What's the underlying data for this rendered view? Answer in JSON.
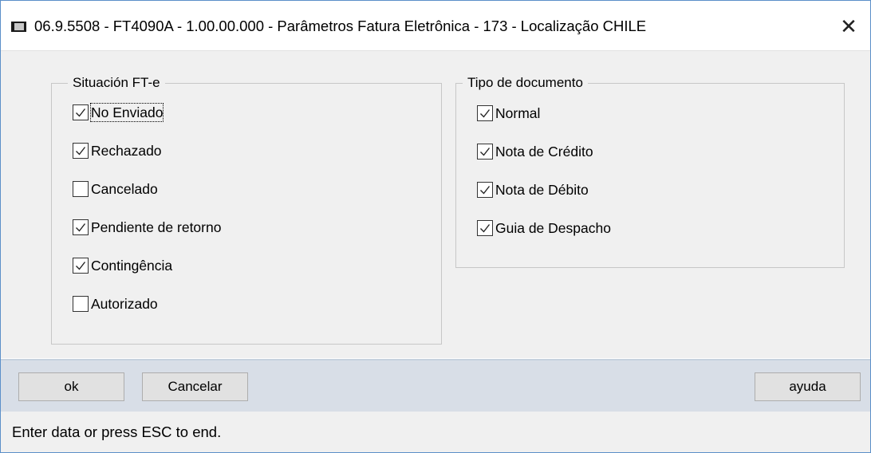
{
  "window": {
    "title": "06.9.5508 - FT4090A - 1.00.00.000 - Parâmetros Fatura Eletrônica - 173 - Localização CHILE",
    "close_glyph": "✕",
    "app_icon": "window-app-icon"
  },
  "situacion": {
    "label": "Situación FT-e",
    "items": [
      {
        "label": "No Enviado",
        "checked": true
      },
      {
        "label": "Rechazado",
        "checked": true
      },
      {
        "label": "Cancelado",
        "checked": false
      },
      {
        "label": "Pendiente de retorno",
        "checked": true
      },
      {
        "label": "Contingência",
        "checked": true
      },
      {
        "label": "Autorizado",
        "checked": false
      }
    ]
  },
  "tipo": {
    "label": "Tipo de documento",
    "items": [
      {
        "label": "Normal",
        "checked": true
      },
      {
        "label": "Nota de Crédito",
        "checked": true
      },
      {
        "label": "Nota de Débito",
        "checked": true
      },
      {
        "label": "Guia de Despacho",
        "checked": true
      }
    ]
  },
  "buttons": {
    "ok": "ok",
    "cancel": "Cancelar",
    "help": "ayuda"
  },
  "status": {
    "text": "Enter data or press ESC to end."
  },
  "colors": {
    "window_border": "#5b8fc9",
    "content_bg": "#f0f0f0",
    "buttonbar_bg": "#d8dee7"
  }
}
